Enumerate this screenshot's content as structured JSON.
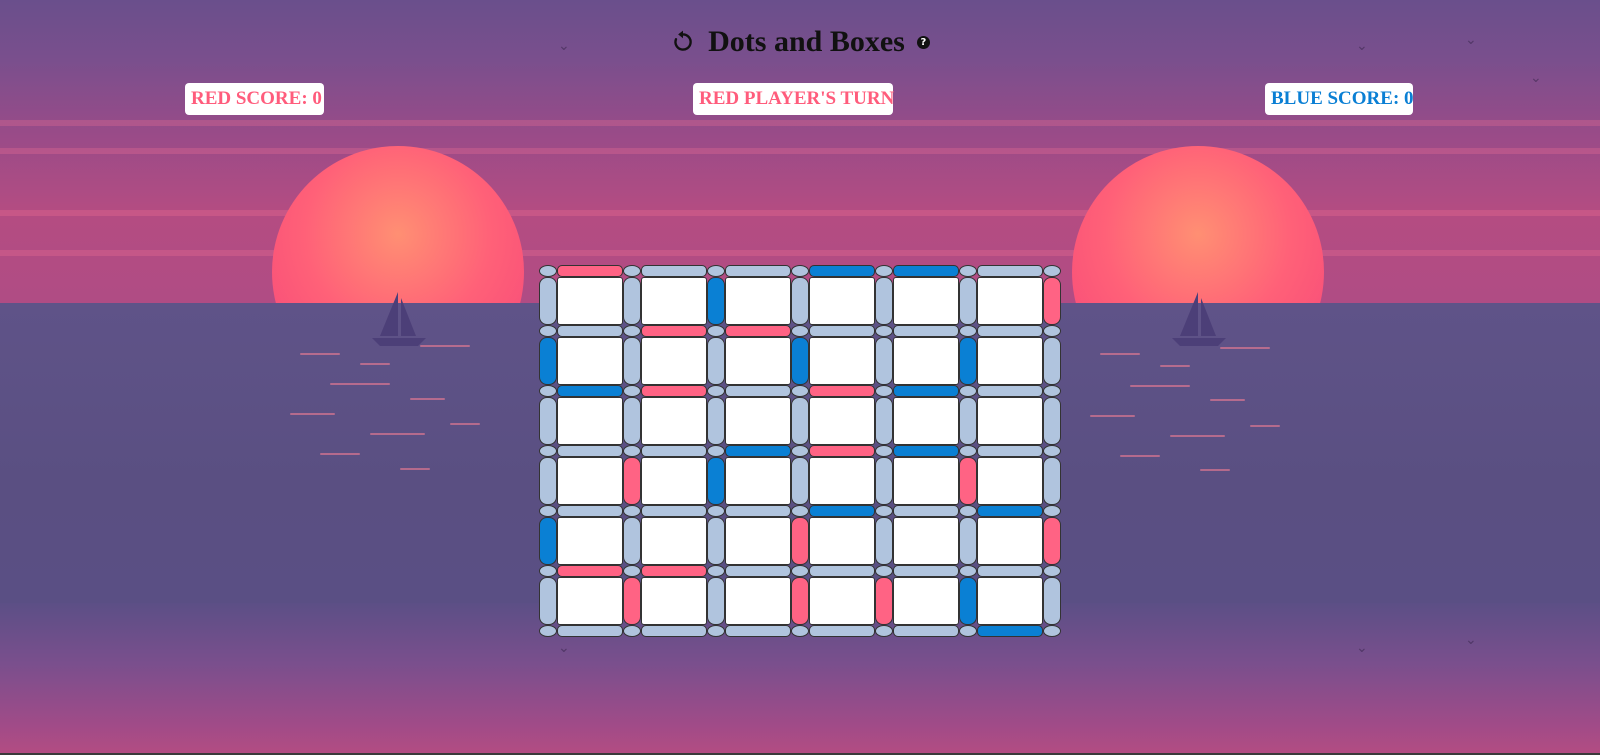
{
  "header": {
    "title": "Dots and Boxes",
    "reset_icon": "reset-icon",
    "help_icon": "help-icon",
    "help_glyph": "?"
  },
  "status": {
    "red_score": "RED SCORE: 0",
    "turn": "RED PLAYER'S TURN",
    "blue_score": "BLUE SCORE: 0"
  },
  "colors": {
    "red": "#ff6384",
    "blue": "#0a80d4",
    "empty_line": "#b0c4de",
    "box": "#ffffff",
    "red_text": "#ff5c7c",
    "blue_text": "#0a7fd4"
  },
  "board": {
    "rows": 6,
    "cols": 6,
    "horizontal_lines": [
      [
        "red",
        "none",
        "none",
        "blue",
        "blue",
        "none"
      ],
      [
        "none",
        "red",
        "red",
        "none",
        "none",
        "none"
      ],
      [
        "blue",
        "red",
        "none",
        "red",
        "blue",
        "none"
      ],
      [
        "none",
        "none",
        "blue",
        "red",
        "blue",
        "none"
      ],
      [
        "none",
        "none",
        "none",
        "blue",
        "none",
        "blue"
      ],
      [
        "red",
        "red",
        "none",
        "none",
        "none",
        "none"
      ],
      [
        "none",
        "none",
        "none",
        "none",
        "none",
        "blue"
      ]
    ],
    "vertical_lines": [
      [
        "none",
        "none",
        "blue",
        "none",
        "none",
        "none",
        "red"
      ],
      [
        "blue",
        "none",
        "none",
        "blue",
        "none",
        "blue",
        "none"
      ],
      [
        "none",
        "none",
        "none",
        "none",
        "none",
        "none",
        "none"
      ],
      [
        "none",
        "red",
        "blue",
        "none",
        "none",
        "red",
        "none"
      ],
      [
        "blue",
        "none",
        "none",
        "red",
        "none",
        "none",
        "red"
      ],
      [
        "none",
        "red",
        "none",
        "red",
        "red",
        "blue",
        "none"
      ]
    ]
  }
}
